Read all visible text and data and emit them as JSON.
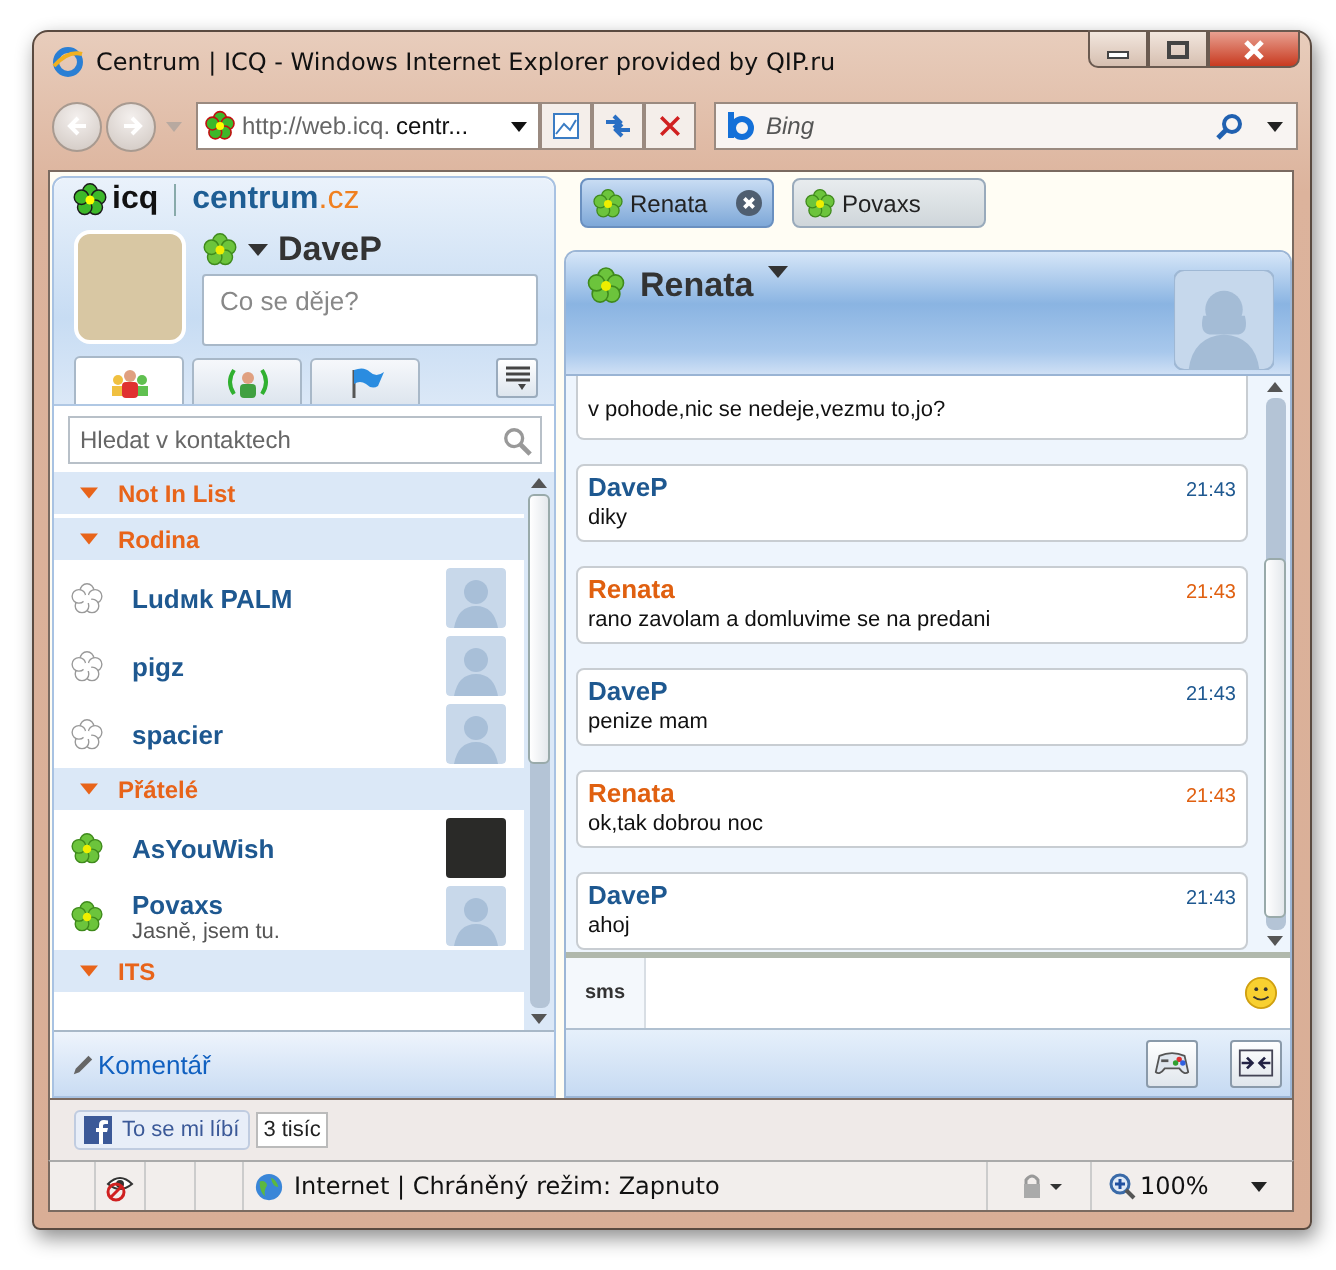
{
  "window": {
    "title": "Centrum | ICQ - Windows Internet Explorer provided by QIP.ru"
  },
  "toolbar": {
    "address_prefix": "http://web.icq.",
    "address_rest": "centr...",
    "search_placeholder": "Bing"
  },
  "sidebar": {
    "logo": {
      "icq": "icq",
      "brand": "centrum",
      "tld": ".cz"
    },
    "user": {
      "name": "DaveP",
      "online": true,
      "status_placeholder": "Co se děje?"
    },
    "tabs": [
      {
        "kind": "contacts",
        "selected": true
      },
      {
        "kind": "broadcast",
        "selected": false
      },
      {
        "kind": "flag",
        "selected": false
      }
    ],
    "search_placeholder": "Hledat v kontaktech",
    "groups": [
      {
        "name": "Not In List",
        "expanded": true
      },
      {
        "name": "Rodina",
        "expanded": true,
        "contacts": [
          {
            "name": "Ludмk PALM",
            "online": false,
            "kind": "silhouette"
          },
          {
            "name": "pigz",
            "online": false,
            "kind": "silhouette"
          },
          {
            "name": "spacier",
            "online": false,
            "kind": "silhouette"
          }
        ]
      },
      {
        "name": "Přátelé",
        "expanded": true,
        "contacts": [
          {
            "name": "AsYouWish",
            "online": true,
            "kind": "photo"
          },
          {
            "name": "Povaxs",
            "online": true,
            "kind": "silhouette",
            "status_text": "Jasně, jsem tu."
          }
        ]
      },
      {
        "name": "ITS",
        "expanded": true
      }
    ],
    "comment_link": "Komentář"
  },
  "chat": {
    "tabs": [
      {
        "name": "Renata",
        "online": true,
        "selected": true
      },
      {
        "name": "Povaxs",
        "online": true,
        "selected": false
      }
    ],
    "header": {
      "name": "Renata",
      "online": true
    },
    "messages": [
      {
        "kind": "incoming",
        "text": "v pohode,nic se nedeje,vezmu to,jo?"
      },
      {
        "kind": "outgoing",
        "author": "DaveP",
        "time": "21:43",
        "text": "diky"
      },
      {
        "kind": "incoming",
        "author": "Renata",
        "time": "21:43",
        "text": "rano zavolam a domluvime se na predani"
      },
      {
        "kind": "outgoing",
        "author": "DaveP",
        "time": "21:43",
        "text": "penize mam"
      },
      {
        "kind": "incoming",
        "author": "Renata",
        "time": "21:43",
        "text": "ok,tak dobrou noc"
      },
      {
        "kind": "outgoing",
        "author": "DaveP",
        "time": "21:43",
        "text": "ahoj"
      }
    ],
    "sms_button": "sms"
  },
  "like_bar": {
    "label": "To se mi líbí",
    "count": "3 tisíc"
  },
  "status_bar": {
    "zone": "Internet | Chráněný režim: Zapnuto",
    "zoom": "100%"
  }
}
